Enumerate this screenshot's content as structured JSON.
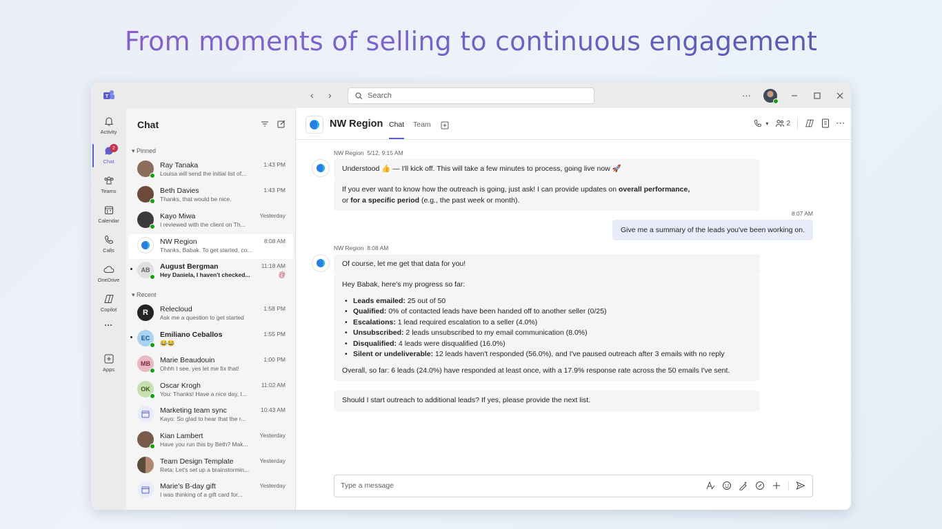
{
  "headline": "From moments of selling to continuous engagement",
  "titlebar": {
    "search_placeholder": "Search",
    "more": "···"
  },
  "rail": {
    "items": [
      {
        "label": "Activity",
        "icon": "bell-icon"
      },
      {
        "label": "Chat",
        "icon": "chat-icon",
        "badge": "2",
        "active": true
      },
      {
        "label": "Teams",
        "icon": "teams-icon"
      },
      {
        "label": "Calendar",
        "icon": "calendar-icon"
      },
      {
        "label": "Calls",
        "icon": "phone-icon"
      },
      {
        "label": "OneDrive",
        "icon": "cloud-icon"
      },
      {
        "label": "Copilot",
        "icon": "copilot-icon"
      },
      {
        "label": "···",
        "icon": "more-icon"
      },
      {
        "label": "Apps",
        "icon": "plus-square-icon"
      }
    ]
  },
  "chatlist": {
    "title": "Chat",
    "pinned_label": "Pinned",
    "recent_label": "Recent",
    "pinned": [
      {
        "name": "Ray Tanaka",
        "preview": "Louisa will send the initial list of...",
        "time": "1:43 PM",
        "initials": "",
        "color": "#8a6e5a"
      },
      {
        "name": "Beth Davies",
        "preview": "Thanks, that would be nice.",
        "time": "1:43 PM",
        "initials": "",
        "color": "#6b4a3a"
      },
      {
        "name": "Kayo Miwa",
        "preview": "I reviewed with the client on Th...",
        "time": "Yesterday",
        "initials": "",
        "color": "#3a3a3a"
      },
      {
        "name": "NW Region",
        "preview": "Thanks, Babak. To get started, co...",
        "time": "8:08 AM",
        "initials": "",
        "color": "#ffffff",
        "selected": true
      },
      {
        "name": "August Bergman",
        "preview": "Hey Daniela, I haven't checked...",
        "time": "11:18 AM",
        "initials": "AB",
        "color": "#e0e0e0",
        "unread": true,
        "mention": "@"
      }
    ],
    "recent": [
      {
        "name": "Relecloud",
        "preview": "Ask me a question to get started",
        "time": "1:58 PM",
        "initials": "",
        "color": "#242424"
      },
      {
        "name": "Emiliano Ceballos",
        "preview": "😂😂",
        "time": "1:55 PM",
        "initials": "EC",
        "color": "#a9d3f2",
        "unread": true
      },
      {
        "name": "Marie Beaudouin",
        "preview": "Ohhh I see, yes let me fix that!",
        "time": "1:00 PM",
        "initials": "MB",
        "color": "#e8b9c3"
      },
      {
        "name": "Oscar Krogh",
        "preview": "You: Thanks! Have a nice day, I...",
        "time": "11:02 AM",
        "initials": "OK",
        "color": "#c5dfae"
      },
      {
        "name": "Marketing team sync",
        "preview": "Kayo: So glad to hear that the r...",
        "time": "10:43 AM",
        "initials": "",
        "color": "#e8ebfa"
      },
      {
        "name": "Kian Lambert",
        "preview": "Have you run this by Beth? Mak...",
        "time": "Yesterday",
        "initials": "",
        "color": "#7a5a4a"
      },
      {
        "name": "Team Design Template",
        "preview": "Reta: Let's set up a brainstormin...",
        "time": "Yesterday",
        "initials": "",
        "color": "#5a4a3a"
      },
      {
        "name": "Marie's B-day gift",
        "preview": "I was thinking of a gift card for...",
        "time": "Yesterday",
        "initials": "",
        "color": "#e8ebfa"
      }
    ]
  },
  "main": {
    "title": "NW Region",
    "tabs": [
      "Chat",
      "Team"
    ],
    "participants": "2",
    "messages": {
      "m1_sender": "NW Region",
      "m1_time": "5/12, 9:15 AM",
      "m1_text": "Understood 👍 — I'll kick off. This will take a few minutes to process, going live now 🚀",
      "m2_pre": "If you ever want to know how the outreach is going, just ask! I can provide updates on ",
      "m2_b1": "overall performance,",
      "m2_or": "or ",
      "m2_b2": "for a specific period",
      "m2_post": " (e.g., the past week or month).",
      "user_time": "8:07 AM",
      "user_text": "Give me a summary of the leads you've been working on.",
      "m3_sender": "NW Region",
      "m3_time": "8:08 AM",
      "m3_text": "Of course, let me get that data for you!",
      "m4_intro": "Hey Babak, here's my progress so far:",
      "m4_items": [
        {
          "label": "Leads emailed:",
          "text": " 25 out of 50"
        },
        {
          "label": "Qualified:",
          "text": " 0% of contacted leads have been handed off to another seller (0/25)"
        },
        {
          "label": "Escalations:",
          "text": " 1 lead required escalation to a seller (4.0%)"
        },
        {
          "label": "Unsubscribed:",
          "text": " 2 leads unsubscribed to my email communication (8.0%)"
        },
        {
          "label": "Disqualified:",
          "text": " 4 leads were disqualified (16.0%)"
        },
        {
          "label": "Silent or undeliverable:",
          "text": " 12 leads haven't responded (56.0%), and I've paused outreach after 3 emails with no reply"
        }
      ],
      "m4_summary": "Overall, so far: 6 leads (24.0%) have responded at least once, with a 17.9% response rate across the 50 emails I've sent.",
      "m5_text": "Should I start outreach to additional leads? If yes, please provide the next list."
    },
    "compose_placeholder": "Type a message"
  }
}
